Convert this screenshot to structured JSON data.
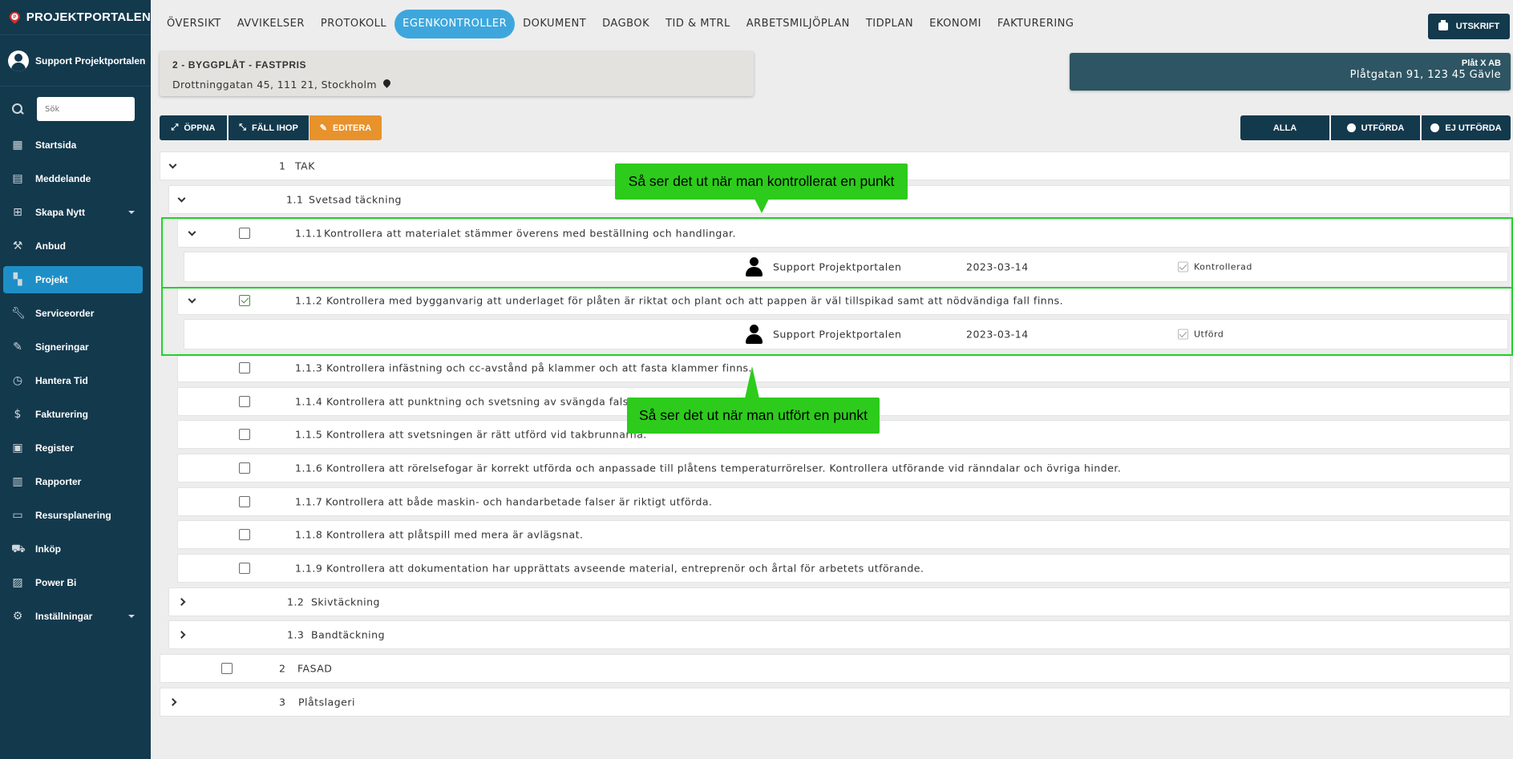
{
  "brand": {
    "title": "PROJEKTPORTALEN",
    "logo_letter": "P"
  },
  "user": {
    "name": "Support Projektportalen"
  },
  "search": {
    "placeholder": "Sök"
  },
  "sidebar": {
    "items": [
      {
        "label": "Startsida",
        "icon": "dashboard-icon"
      },
      {
        "label": "Meddelande",
        "icon": "message-icon"
      },
      {
        "label": "Skapa Nytt",
        "icon": "add-box-icon",
        "has_caret": true
      },
      {
        "label": "Anbud",
        "icon": "gavel-icon"
      },
      {
        "label": "Projekt",
        "icon": "grid-icon",
        "active": true
      },
      {
        "label": "Serviceorder",
        "icon": "wrench-icon"
      },
      {
        "label": "Signeringar",
        "icon": "pencil-icon"
      },
      {
        "label": "Hantera Tid",
        "icon": "clock-icon"
      },
      {
        "label": "Fakturering",
        "icon": "dollar-icon"
      },
      {
        "label": "Register",
        "icon": "image-icon"
      },
      {
        "label": "Rapporter",
        "icon": "calendar-icon"
      },
      {
        "label": "Resursplanering",
        "icon": "calendar-blank-icon"
      },
      {
        "label": "Inköp",
        "icon": "cart-icon"
      },
      {
        "label": "Power Bi",
        "icon": "chart-icon"
      },
      {
        "label": "Inställningar",
        "icon": "gear-icon",
        "has_caret": true
      }
    ]
  },
  "tabs": [
    {
      "label": "ÖVERSIKT"
    },
    {
      "label": "AVVIKELSER"
    },
    {
      "label": "PROTOKOLL"
    },
    {
      "label": "EGENKONTROLLER",
      "active": true
    },
    {
      "label": "DOKUMENT"
    },
    {
      "label": "DAGBOK"
    },
    {
      "label": "TID & MTRL"
    },
    {
      "label": "ARBETSMILJÖPLAN"
    },
    {
      "label": "TIDPLAN"
    },
    {
      "label": "EKONOMI"
    },
    {
      "label": "FAKTURERING"
    }
  ],
  "print_button": "UTSKRIFT",
  "project": {
    "title": "2 - BYGGPLÅT - FASTPRIS",
    "address": "Drottninggatan 45, 111 21, Stockholm"
  },
  "company": {
    "name": "Plåt X AB",
    "address": "Plåtgatan 91, 123 45 Gävle"
  },
  "toolbar": {
    "open": "ÖPPNA",
    "collapse": "FÄLL IHOP",
    "edit": "EDITERA"
  },
  "filters": {
    "all": "ALLA",
    "done": "UTFÖRDA",
    "not_done": "EJ UTFÖRDA"
  },
  "tree": {
    "section_1": {
      "num": "1",
      "label": "TAK"
    },
    "section_1_1": {
      "num": "1.1",
      "label": "Svetsad täckning"
    },
    "items": [
      {
        "num": "1.1.1",
        "label": "Kontrollera att materialet stämmer överens med beställning och handlingar.",
        "checked": false
      },
      {
        "num": "1.1.2",
        "label": "Kontrollera med bygganvarig att underlaget för plåten är riktat och plant och att pappen är väl tillspikad samt att nödvändiga fall finns.",
        "checked": true
      },
      {
        "num": "1.1.3",
        "label": "Kontrollera infästning och cc-avstånd på klammer och att fasta klammer finns.",
        "checked": false
      },
      {
        "num": "1.1.4",
        "label": "Kontrollera att punktning och svetsning av svängda falsar är väl utförd.",
        "checked": false
      },
      {
        "num": "1.1.5",
        "label": "Kontrollera att svetsningen är rätt utförd vid takbrunnarna.",
        "checked": false
      },
      {
        "num": "1.1.6",
        "label": "Kontrollera att rörelsefogar är korrekt utförda och anpassade till plåtens temperaturrörelser. Kontrollera utförande vid ränndalar och övriga hinder.",
        "checked": false
      },
      {
        "num": "1.1.7",
        "label": "Kontrollera att både maskin- och handarbetade falser är riktigt utförda.",
        "checked": false
      },
      {
        "num": "1.1.8",
        "label": "Kontrollera att plåtspill med mera är avlägsnat.",
        "checked": false
      },
      {
        "num": "1.1.9",
        "label": "Kontrollera att dokumentation har upprättats avseende material, entreprenör och årtal för arbetets utförande.",
        "checked": false
      }
    ],
    "details": [
      {
        "person": "Support Projektportalen",
        "date": "2023-03-14",
        "status": "Kontrollerad"
      },
      {
        "person": "Support Projektportalen",
        "date": "2023-03-14",
        "status": "Utförd"
      }
    ],
    "section_1_2": {
      "num": "1.2",
      "label": "Skivtäckning"
    },
    "section_1_3": {
      "num": "1.3",
      "label": "Bandtäckning"
    },
    "section_2": {
      "num": "2",
      "label": "FASAD"
    },
    "section_3": {
      "num": "3",
      "label": "Plåtslageri"
    }
  },
  "annotations": {
    "controlled": "Så ser det ut när man kontrollerat en punkt",
    "done": "Så ser det ut när man utfört en punkt"
  },
  "colors": {
    "sidebar": "#13394d",
    "active_blue": "#1e8fc6",
    "tab_active": "#3da7dd",
    "edit_orange": "#e8922c",
    "annotation_green": "#2dcb1c"
  }
}
